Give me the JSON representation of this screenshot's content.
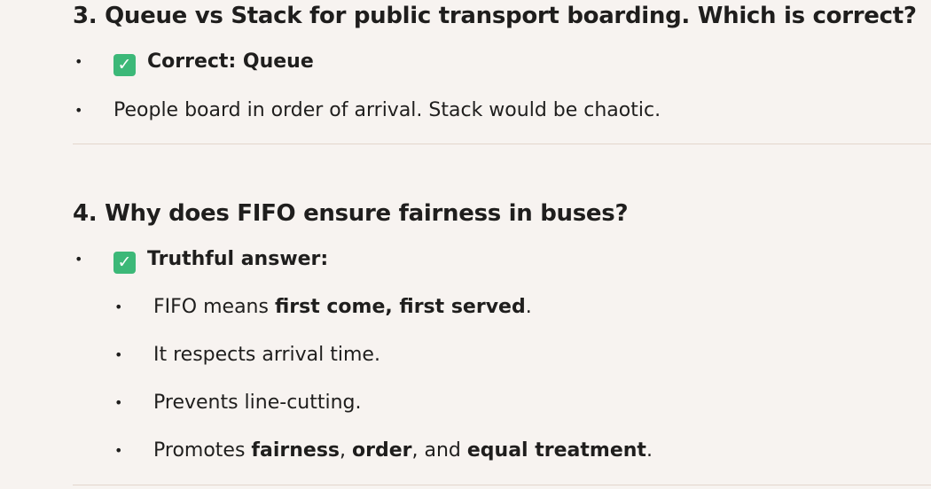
{
  "q3": {
    "title": "3. Queue vs Stack for public transport boarding. Which is correct?",
    "check_icon": "✓",
    "correct_label": "Correct: Queue",
    "explanation": "People board in order of arrival. Stack would be chaotic."
  },
  "q4": {
    "title": "4. Why does FIFO ensure fairness in buses?",
    "check_icon": "✓",
    "answer_label": "Truthful answer:",
    "points": {
      "p1_pre": "FIFO means ",
      "p1_bold": "first come, first served",
      "p1_post": ".",
      "p2": "It respects arrival time.",
      "p3": "Prevents line-cutting.",
      "p4_pre": "Promotes ",
      "p4_b1": "fairness",
      "p4_sep1": ", ",
      "p4_b2": "order",
      "p4_sep2": ", and ",
      "p4_b3": "equal treatment",
      "p4_post": "."
    }
  },
  "bullet_char": "•",
  "colors": {
    "background": "#f7f3f0",
    "text": "#1f1e1d",
    "check_green": "#3cb878",
    "divider": "#e3d6cc"
  }
}
